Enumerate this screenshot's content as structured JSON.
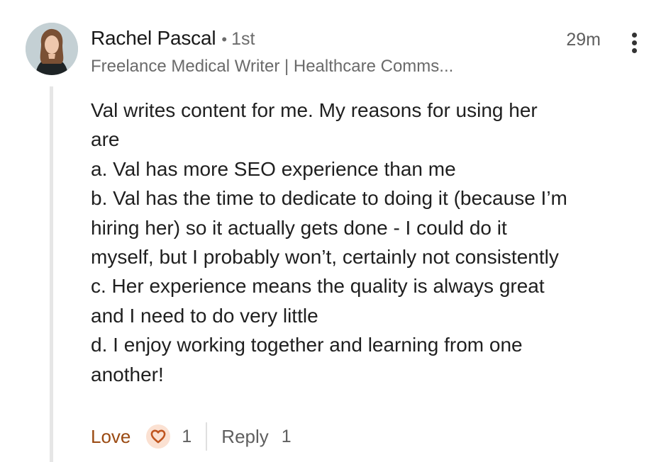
{
  "comment": {
    "author": {
      "name": "Rachel Pascal",
      "separator": "•",
      "connection_degree": "1st",
      "headline": "Freelance Medical Writer | Healthcare Comms..."
    },
    "timestamp": "29m",
    "menu_icon": "more-vertical-icon",
    "body_lines": [
      "Val writes content for me. My reasons for using her",
      "are",
      "a. Val has more SEO experience than me",
      "b. Val has the time to dedicate to doing it (because I’m",
      "hiring her) so it actually gets done - I could do it",
      "myself, but I probably won’t, certainly not consistently",
      "c. Her experience means the quality is always great",
      "and I need to do very little",
      "d. I enjoy working together and learning from one",
      "another!"
    ],
    "actions": {
      "love_label": "Love",
      "love_icon": "heart-icon",
      "love_count": "1",
      "reply_label": "Reply",
      "reply_count": "1"
    }
  },
  "colors": {
    "love_text": "#9a4a12",
    "heart": "#c0551f",
    "heart_bg": "#fbe1d2",
    "secondary_text": "#6a6a6a",
    "thread_line": "#e6e6e6"
  }
}
